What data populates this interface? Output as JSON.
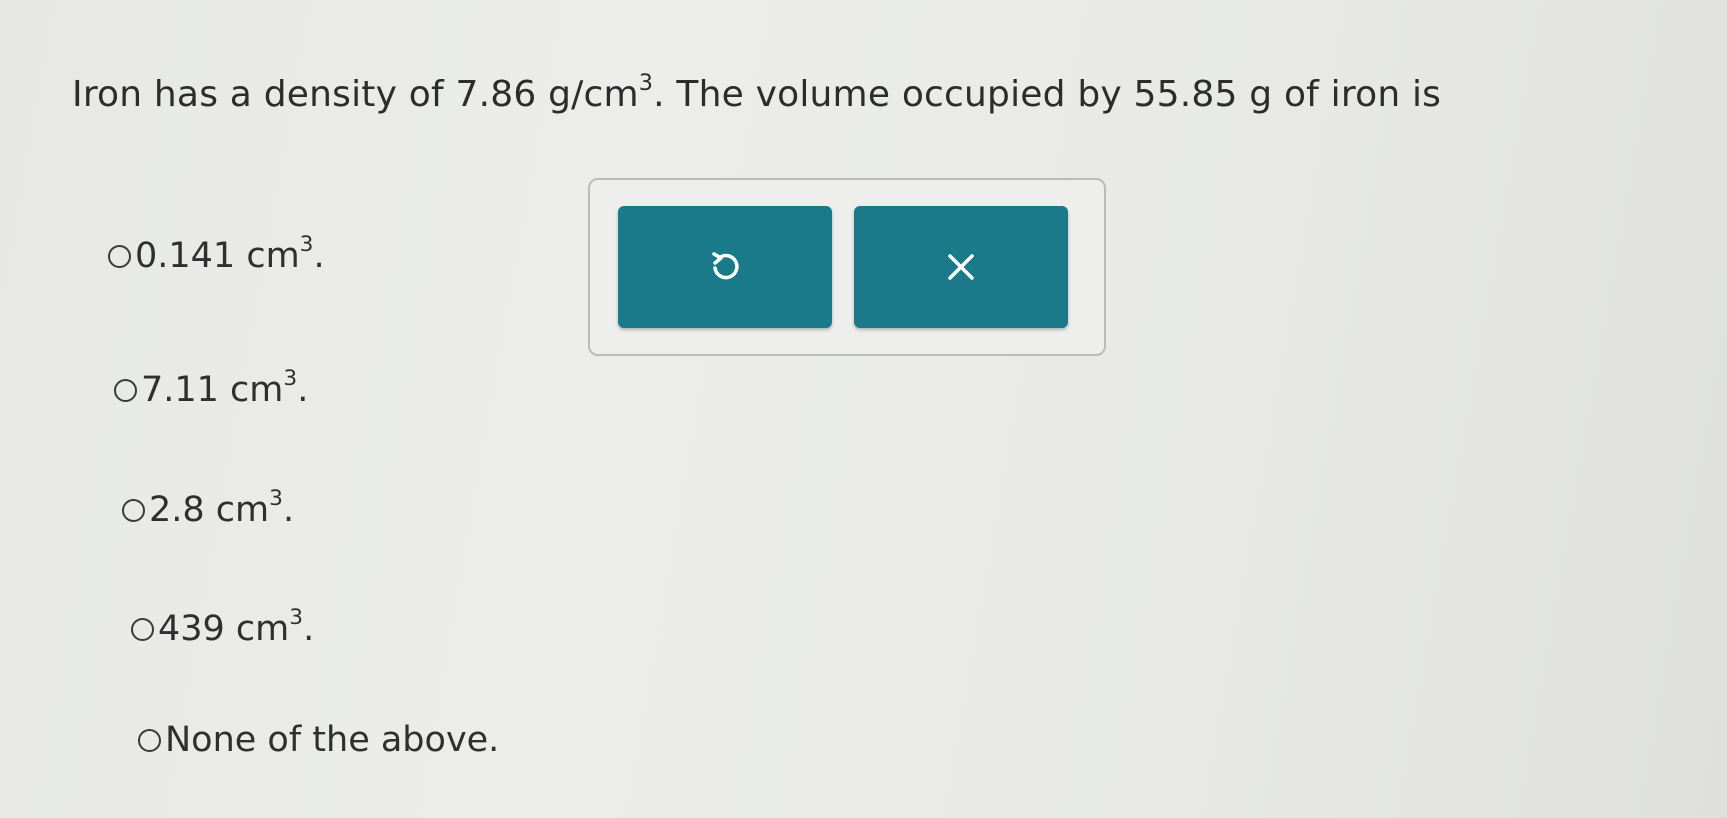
{
  "question": {
    "prefix": "Iron has a density of 7.86 g/cm",
    "exp": "3",
    "suffix": ". The volume occupied by 55.85 g of iron is"
  },
  "options": [
    {
      "value": "0.141 cm",
      "exp": "3",
      "end": "."
    },
    {
      "value": "7.11 cm",
      "exp": "3",
      "end": "."
    },
    {
      "value": "2.8 cm",
      "exp": "3",
      "end": "."
    },
    {
      "value": "439 cm",
      "exp": "3",
      "end": "."
    },
    {
      "value": "None of the above.",
      "exp": "",
      "end": ""
    }
  ],
  "toolbar": {
    "undo_icon": "undo-icon",
    "clear_icon": "close-icon",
    "accent_color": "#1a7a8a"
  }
}
